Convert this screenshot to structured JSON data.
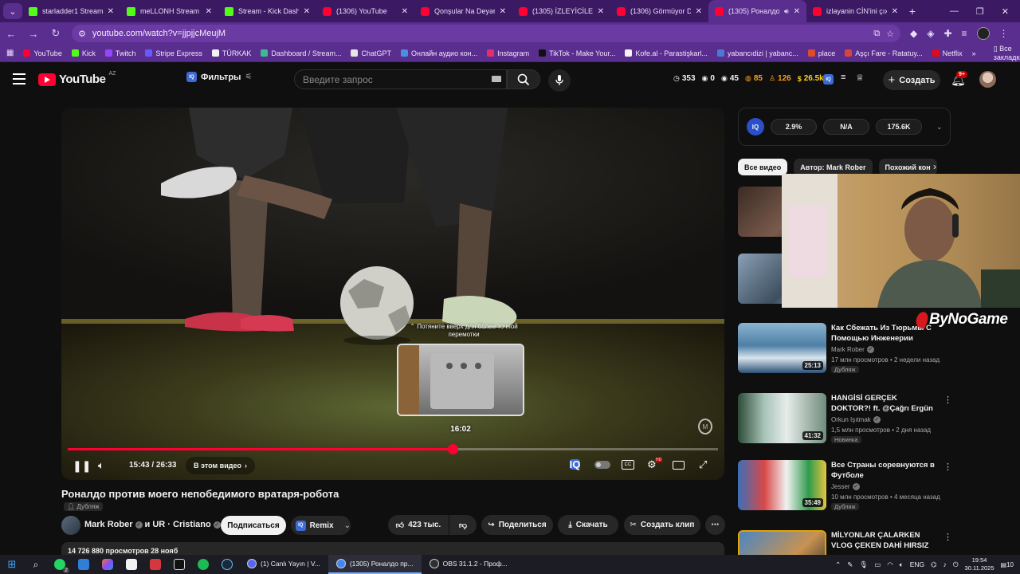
{
  "browser": {
    "tabs": [
      {
        "title": "starladder1 Stream -",
        "favicon": "kick",
        "active": false
      },
      {
        "title": "meLLONH Stream - W",
        "favicon": "kick",
        "active": false
      },
      {
        "title": "Stream - Kick Dashbc",
        "favicon": "kick",
        "active": false
      },
      {
        "title": "(1306) YouTube",
        "favicon": "youtube",
        "active": false
      },
      {
        "title": "Qonşular Na Deyər -",
        "favicon": "youtube",
        "active": false
      },
      {
        "title": "(1305) İZLEYİCİLERİN",
        "favicon": "youtube",
        "active": false
      },
      {
        "title": "(1306) Görmüyor Du",
        "favicon": "youtube",
        "active": false
      },
      {
        "title": "(1305) Роналдо",
        "favicon": "youtube",
        "active": true
      },
      {
        "title": "izlayanin CİN'ini çıxa",
        "favicon": "youtube",
        "active": false
      }
    ],
    "url": "youtube.com/watch?v=jjpjjcMeujM",
    "bookmarks": [
      "YouTube",
      "Kick",
      "Twitch",
      "Stripe Express",
      "TÜRKAK",
      "Dashboard / Stream...",
      "ChatGPT",
      "Онлайн аудио кон...",
      "Instagram",
      "TikTok - Make Your...",
      "Kofe.al - Parastişkarl...",
      "yabancıdizi | yabanc...",
      "place",
      "Aşçı Fare - Ratatuy...",
      "Netflix"
    ],
    "all_bookmarks": "Все закладки"
  },
  "youtube": {
    "logo": "YouTube",
    "region": "AZ",
    "filters_label": "Фильтры",
    "search_placeholder": "Введите запрос",
    "stats": [
      {
        "icon": "clock-icon",
        "value": "353",
        "color": "#f1f1f1"
      },
      {
        "icon": "eye-icon",
        "value": "0",
        "color": "#f1f1f1"
      },
      {
        "icon": "eye-icon",
        "value": "45",
        "color": "#f1f1f1"
      },
      {
        "icon": "coin-icon",
        "value": "85",
        "color": "#ff9f1a"
      },
      {
        "icon": "user-icon",
        "value": "126",
        "color": "#ff9f1a"
      },
      {
        "icon": "money-icon",
        "value": "26.5k",
        "color": "#ffd21a"
      }
    ],
    "create_label": "Создать",
    "notifications": "9+"
  },
  "player": {
    "scrub_hint": "Потяните вверх для более точной перемотки",
    "preview_time": "16:02",
    "time_display": "15:43 / 26:33",
    "chapter_label": "В этом видео",
    "progress": 0.592,
    "hd_badge": "HD"
  },
  "video": {
    "title": "Роналдо против моего непобедимого вратаря-робота",
    "dub_label": "Дубляж",
    "channel": "Mark Rober",
    "channel_collab": "и UR · Cristiano",
    "subscribe_label": "Подписаться",
    "remix_label": "Remix",
    "likes": "423 тыс.",
    "share_label": "Поделиться",
    "download_label": "Скачать",
    "clip_label": "Создать клип",
    "views": "14 726 880 просмотров  28 нояб"
  },
  "sidebar": {
    "iq_metrics": [
      "2.9%",
      "N/A",
      "175.6K"
    ],
    "chips": [
      "Все видео",
      "Автор: Mark Rober",
      "Похожий кон"
    ],
    "recommendations": [
      {
        "title": "Как Сбежать Из Тюрьмы С Помощью Инженерии",
        "channel": "Mark Rober",
        "meta": "17 млн просмотров • 2 недели назад",
        "duration": "25:13",
        "badge": "Дубляж"
      },
      {
        "title": "HANGİSİ GERÇEK DOKTOR?! ft. @Çağrı Ergün",
        "channel": "Orkun Işıtmak",
        "meta": "1,5 млн просмотров • 2 дня назад",
        "duration": "41:32",
        "badge": "Новинка"
      },
      {
        "title": "Все Страны соревнуются в Футболе",
        "channel": "Jesser",
        "meta": "10 млн просмотров • 4 месяца назад",
        "duration": "35:49",
        "badge": "Дубляж"
      },
      {
        "title": "MİLYONLAR ÇALARKEN VLOG ÇEKEN DAHİ HIRSIZ",
        "channel": "",
        "meta": "",
        "duration": "",
        "badge": ""
      }
    ],
    "overlay_brand": "ByNoGame"
  },
  "taskbar": {
    "apps": [
      {
        "label": "(1) Canlı Yayın | V...",
        "active": false
      },
      {
        "label": "(1305) Роналдо пр...",
        "active": true
      },
      {
        "label": "OBS 31.1.2 - Проф...",
        "active": false
      }
    ],
    "whatsapp_badge": "2",
    "language": "ENG",
    "time": "19:54",
    "date": "30.11.2025",
    "notif_count": "10"
  }
}
